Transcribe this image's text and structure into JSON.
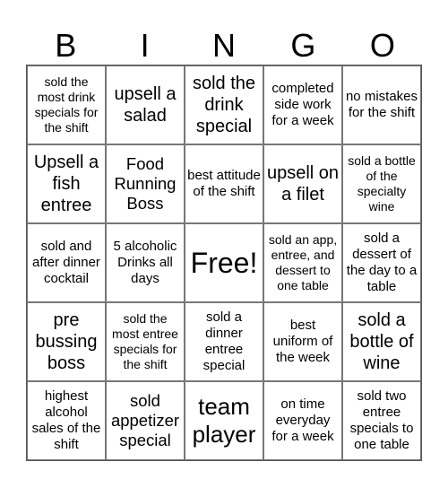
{
  "header": [
    "B",
    "I",
    "N",
    "G",
    "O"
  ],
  "cells": [
    "sold the most drink specials for the shift",
    "upsell a salad",
    "sold the drink special",
    "completed side work for a week",
    "no mistakes for the shift",
    "Upsell a fish entree",
    "Food Running Boss",
    "best attitude of the shift",
    "upsell on a filet",
    "sold a bottle of the specialty wine",
    "sold and after dinner cocktail",
    "5 alcoholic Drinks all days",
    "Free!",
    "sold an app, entree, and dessert to one table",
    "sold a dessert of the day to a table",
    "pre bussing boss",
    "sold the most entree specials for the shift",
    "sold a dinner entree special",
    "best uniform of the week",
    "sold a bottle of wine",
    "highest alcohol sales of the shift",
    "sold appetizer special",
    "team player",
    "on time everyday for a week",
    "sold two entree specials to one table"
  ]
}
